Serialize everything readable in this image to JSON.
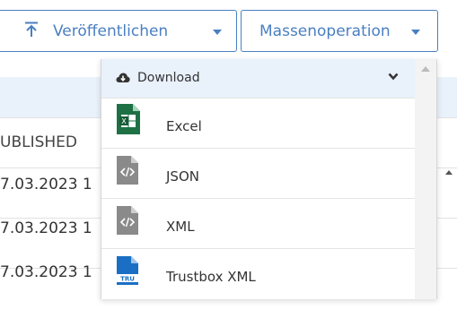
{
  "toolbar": {
    "publish_label": "Veröffentlichen",
    "mass_label": "Massenoperation"
  },
  "table": {
    "column_header": "UBLISHED",
    "rows": [
      "7.03.2023 1",
      "7.03.2023 1",
      "7.03.2023 1"
    ]
  },
  "dropdown": {
    "header_label": "Download",
    "items": [
      {
        "label": "Excel",
        "icon": "excel-file-icon"
      },
      {
        "label": "JSON",
        "icon": "code-file-icon"
      },
      {
        "label": "XML",
        "icon": "code-file-icon"
      },
      {
        "label": "Trustbox XML",
        "icon": "trustbox-file-icon",
        "badge": "TRU"
      }
    ]
  },
  "colors": {
    "accent": "#4a7fc1",
    "excel": "#1e7145",
    "code_file": "#8a8a8a",
    "trustbox": "#1a6fc4",
    "header_band": "#e9f1fb"
  }
}
